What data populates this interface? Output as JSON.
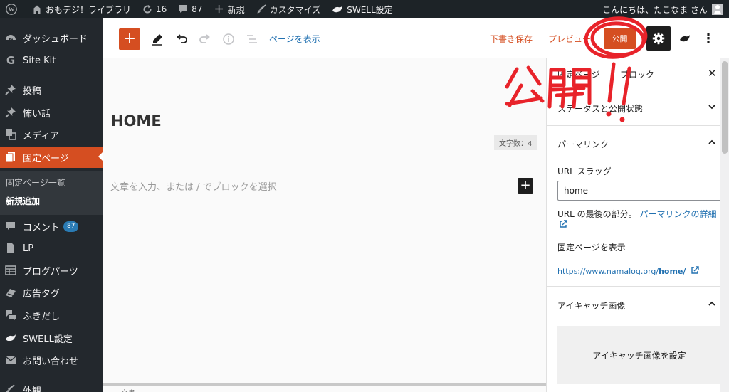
{
  "adminbar": {
    "site_name": "おもデジ！ライブラリ",
    "updates_count": "16",
    "comments_count": "87",
    "new_label": "新規",
    "customize_label": "カスタマイズ",
    "swell_label": "SWELL設定",
    "greeting": "こんにちは、たこなま さん"
  },
  "sidebar": {
    "items": [
      {
        "label": "ダッシュボード",
        "icon": "dashboard-icon"
      },
      {
        "label": "Site Kit",
        "icon": "google-icon"
      },
      {
        "label": "投稿",
        "icon": "pin-icon"
      },
      {
        "label": "怖い話",
        "icon": "pin-icon"
      },
      {
        "label": "メディア",
        "icon": "media-icon"
      },
      {
        "label": "固定ページ",
        "icon": "pages-icon"
      },
      {
        "label": "コメント",
        "icon": "comment-icon",
        "badge": "87"
      },
      {
        "label": "LP",
        "icon": "document-icon"
      },
      {
        "label": "ブログパーツ",
        "icon": "table-icon"
      },
      {
        "label": "広告タグ",
        "icon": "ad-icon"
      },
      {
        "label": "ふきだし",
        "icon": "speech-bubbles-icon"
      },
      {
        "label": "SWELL設定",
        "icon": "swell-icon"
      },
      {
        "label": "お問い合わせ",
        "icon": "mail-icon"
      },
      {
        "label": "外観",
        "icon": "appearance-icon"
      }
    ],
    "submenu": [
      "固定ページ一覧",
      "新規追加"
    ]
  },
  "header": {
    "view_page": "ページを表示",
    "save_draft": "下書き保存",
    "preview": "プレビュー",
    "publish": "公開"
  },
  "canvas": {
    "title": "HOME",
    "char_count": "文字数：4",
    "placeholder": "文章を入力、または / でブロックを選択",
    "footer_text": "文書"
  },
  "settings": {
    "tab_page": "固定ページ",
    "tab_block": "ブロック",
    "status_panel": "ステータスと公開状態",
    "permalink_panel": "パーマリンク",
    "url_slug_label": "URL スラッグ",
    "url_slug_value": "home",
    "url_note": "URL の最後の部分。",
    "url_note_link": "パーマリンクの詳細",
    "view_page_label": "固定ページを表示",
    "page_url_prefix": "https://www.namalog.org/",
    "page_url_slug": "home/",
    "featured_panel": "アイキャッチ画像",
    "set_featured": "アイキャッチ画像を設定"
  },
  "annotation": {
    "text": "公開!!",
    "color": "#e8232a"
  },
  "colors": {
    "accent": "#d54e21",
    "adminbar": "#1d2327",
    "sidebar": "#23282d",
    "link": "#2271b1"
  }
}
